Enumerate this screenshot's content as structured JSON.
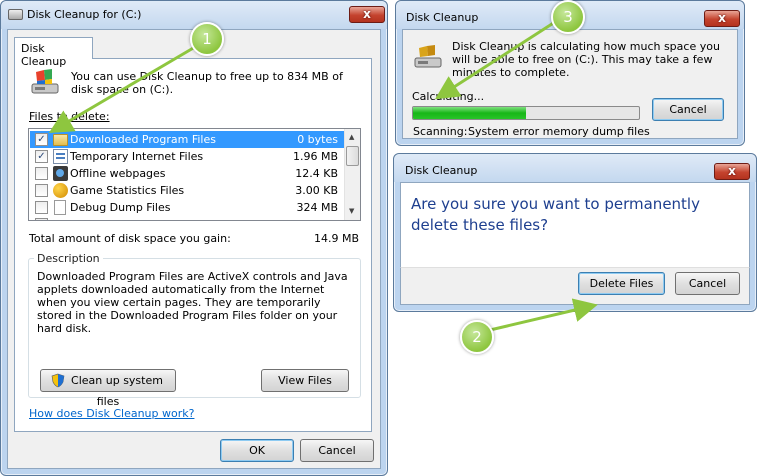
{
  "main_window": {
    "title": "Disk Cleanup for  (C:)",
    "close_label": "x",
    "tab_label": "Disk Cleanup",
    "intro_text": "You can use Disk Cleanup to free up to 834 MB of disk space on  (C:).",
    "files_label": "Files to delete:",
    "files": [
      {
        "name": "Downloaded Program Files",
        "size": "0 bytes",
        "checked": true,
        "icon": "folder-icon"
      },
      {
        "name": "Temporary Internet Files",
        "size": "1.96 MB",
        "checked": true,
        "icon": "internet-files-icon"
      },
      {
        "name": "Offline webpages",
        "size": "12.4 KB",
        "checked": false,
        "icon": "offline-webpages-icon"
      },
      {
        "name": "Game Statistics Files",
        "size": "3.00 KB",
        "checked": false,
        "icon": "game-statistics-icon"
      },
      {
        "name": "Debug Dump Files",
        "size": "324 MB",
        "checked": false,
        "icon": "file-icon"
      }
    ],
    "total_label": "Total amount of disk space you gain:",
    "total_value": "14.9 MB",
    "description_label": "Description",
    "description_text": "Downloaded Program Files are ActiveX controls and Java applets downloaded automatically from the Internet when you view certain pages. They are temporarily stored in the Downloaded Program Files folder on your hard disk.",
    "cleanup_system_files_label": "Clean up system files",
    "view_files_label": "View Files",
    "help_link": "How does Disk Cleanup work?",
    "ok_label": "OK",
    "cancel_label": "Cancel"
  },
  "calc_window": {
    "title": "Disk Cleanup",
    "close_label": "x",
    "message": "Disk Cleanup is calculating how much space you will be able to free on  (C:). This may take a few minutes to complete.",
    "calculating_label": "Calculating...",
    "progress": 0.5,
    "cancel_label": "Cancel",
    "scanning_label": "Scanning:",
    "scanning_item": "System error memory dump files"
  },
  "confirm_window": {
    "title": "Disk Cleanup",
    "close_label": "x",
    "question": "Are you sure you want to permanently delete these files?",
    "delete_label": "Delete Files",
    "cancel_label": "Cancel"
  },
  "markers": [
    "1",
    "2",
    "3"
  ],
  "colors": {
    "accent": "#8ec63f",
    "selection": "#3399ff",
    "question_text": "#1e3f8f",
    "link": "#0066cc"
  }
}
